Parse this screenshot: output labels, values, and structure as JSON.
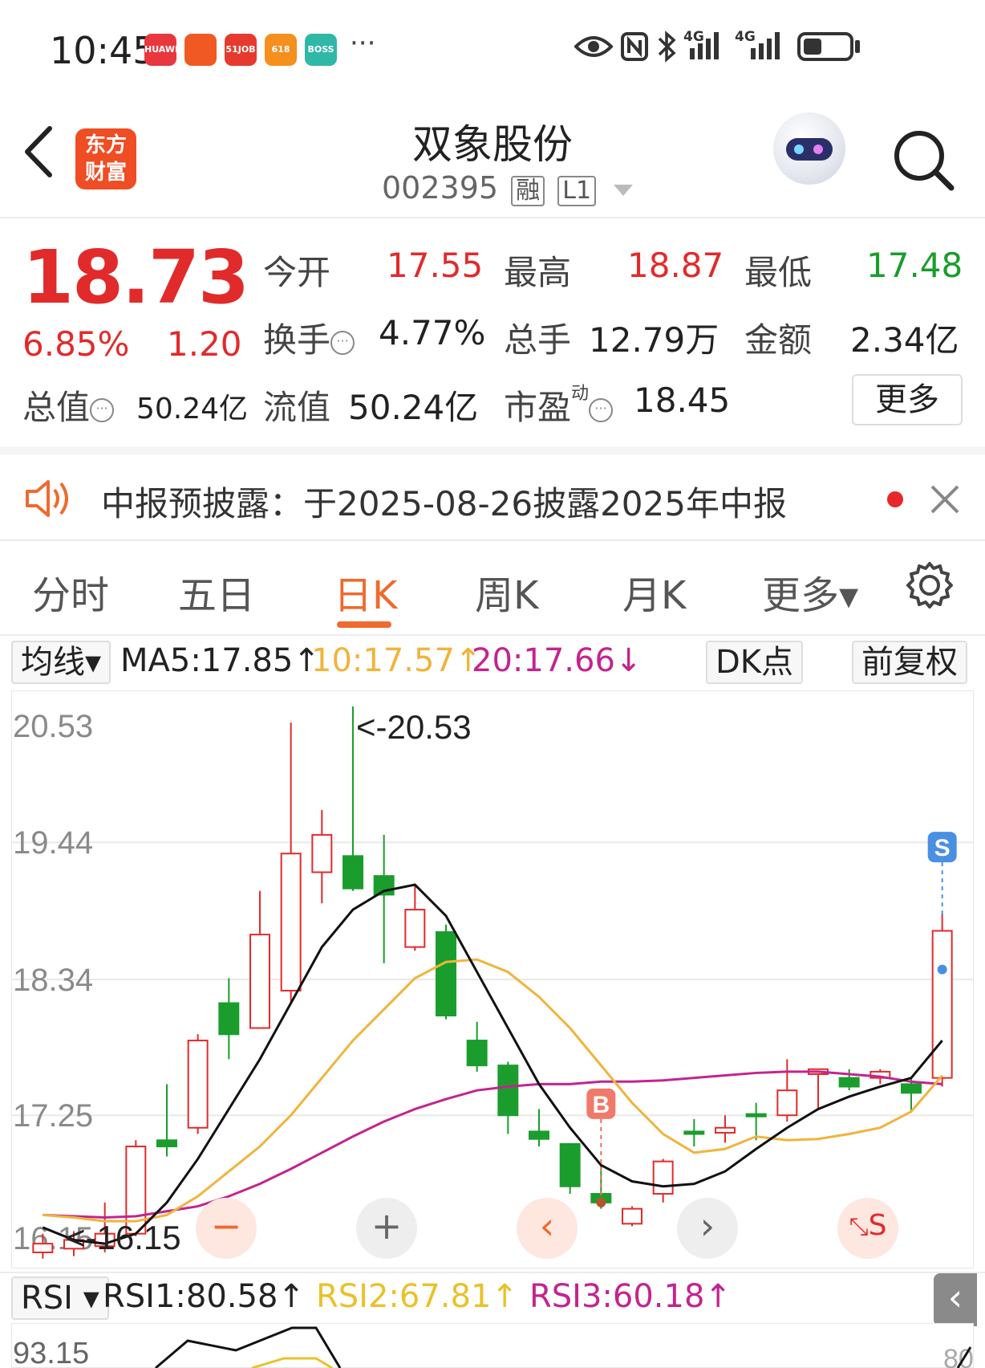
{
  "status_bar": {
    "time": "10:45",
    "apps": [
      {
        "name": "huawei-appgallery-icon",
        "label": "HUAWEI",
        "color": "#e8383d"
      },
      {
        "name": "flash-app-icon",
        "label": "",
        "color": "#f05a22"
      },
      {
        "name": "job-51-app-icon",
        "label": "51JOB",
        "color": "#e63a2e"
      },
      {
        "name": "shopping-618-app-icon",
        "label": "618",
        "color": "#f58f1e"
      },
      {
        "name": "boss-zhipin-app-icon",
        "label": "BOSS 直聘",
        "color": "#2fb7a8"
      }
    ],
    "more": "···",
    "signal_1": "4G",
    "signal_2": "4G"
  },
  "header": {
    "logo_text": "东方\n财富",
    "title": "双象股份",
    "code": "002395",
    "tag_1": "融",
    "tag_2": "L1"
  },
  "quote": {
    "price": "18.73",
    "change_pct": "6.85%",
    "change_amt": "1.20",
    "open_label": "今开",
    "open_value": "17.55",
    "high_label": "最高",
    "high_value": "18.87",
    "low_label": "最低",
    "low_value": "17.48",
    "turnover_label": "换手",
    "turnover_value": "4.77%",
    "volume_label": "总手",
    "volume_value": "12.79万",
    "amount_label": "金额",
    "amount_value": "2.34亿",
    "mktcap_label": "总值",
    "mktcap_value": "50.24亿",
    "float_label": "流值",
    "float_value": "50.24亿",
    "pe_label": "市盈",
    "pe_super": "动",
    "pe_value": "18.45",
    "more_button": "更多"
  },
  "notice": {
    "text": "中报预披露：于2025-08-26披露2025年中报"
  },
  "tabs": [
    "分时",
    "五日",
    "日K",
    "周K",
    "月K",
    "更多▾"
  ],
  "active_tab": 2,
  "indicator": {
    "select_label": "均线▾",
    "ma5": "MA5:17.85↑",
    "ma10": "10:17.57↑",
    "ma20": "20:17.66↓",
    "dk_button": "DK点",
    "adjust_button": "前复权"
  },
  "chart_data": {
    "type": "candlestick",
    "y_ticks": [
      "20.53",
      "19.44",
      "18.34",
      "17.25",
      "16.15"
    ],
    "ylim": [
      16.15,
      20.53
    ],
    "max_label": "<-20.53",
    "min_label": "<-16.15",
    "candles": [
      {
        "o": 16.15,
        "c": 16.22,
        "h": 16.3,
        "l": 16.1
      },
      {
        "o": 16.18,
        "c": 16.25,
        "h": 16.32,
        "l": 16.12
      },
      {
        "o": 16.2,
        "c": 16.3,
        "h": 16.55,
        "l": 16.15
      },
      {
        "o": 16.3,
        "c": 17.0,
        "h": 17.05,
        "l": 16.28
      },
      {
        "o": 17.05,
        "c": 17.0,
        "h": 17.5,
        "l": 16.92
      },
      {
        "o": 17.15,
        "c": 17.85,
        "h": 17.9,
        "l": 17.1
      },
      {
        "o": 18.15,
        "c": 17.9,
        "h": 18.35,
        "l": 17.7
      },
      {
        "o": 17.95,
        "c": 18.7,
        "h": 19.05,
        "l": 17.95
      },
      {
        "o": 18.25,
        "c": 19.35,
        "h": 20.4,
        "l": 18.15
      },
      {
        "o": 19.2,
        "c": 19.5,
        "h": 19.7,
        "l": 18.95
      },
      {
        "o": 19.33,
        "c": 19.07,
        "h": 20.53,
        "l": 19.05
      },
      {
        "o": 19.17,
        "c": 19.02,
        "h": 19.5,
        "l": 18.47
      },
      {
        "o": 18.6,
        "c": 18.9,
        "h": 19.1,
        "l": 18.57
      },
      {
        "o": 18.72,
        "c": 18.05,
        "h": 18.78,
        "l": 18.02
      },
      {
        "o": 17.85,
        "c": 17.65,
        "h": 18.0,
        "l": 17.6
      },
      {
        "o": 17.65,
        "c": 17.25,
        "h": 17.68,
        "l": 17.1
      },
      {
        "o": 17.12,
        "c": 17.06,
        "h": 17.3,
        "l": 17.0
      },
      {
        "o": 17.02,
        "c": 16.68,
        "h": 17.02,
        "l": 16.62
      },
      {
        "o": 16.62,
        "c": 16.55,
        "h": 16.85,
        "l": 16.5
      },
      {
        "o": 16.38,
        "c": 16.5,
        "h": 16.52,
        "l": 16.36
      },
      {
        "o": 16.62,
        "c": 16.88,
        "h": 16.9,
        "l": 16.55
      },
      {
        "o": 17.12,
        "c": 17.1,
        "h": 17.22,
        "l": 17.0
      },
      {
        "o": 17.11,
        "c": 17.15,
        "h": 17.25,
        "l": 17.03
      },
      {
        "o": 17.26,
        "c": 17.25,
        "h": 17.35,
        "l": 17.05
      },
      {
        "o": 17.25,
        "c": 17.45,
        "h": 17.7,
        "l": 17.2
      },
      {
        "o": 17.58,
        "c": 17.62,
        "h": 17.62,
        "l": 17.3
      },
      {
        "o": 17.55,
        "c": 17.48,
        "h": 17.62,
        "l": 17.45
      },
      {
        "o": 17.55,
        "c": 17.6,
        "h": 17.62,
        "l": 17.5
      },
      {
        "o": 17.5,
        "c": 17.43,
        "h": 17.55,
        "l": 17.27
      },
      {
        "o": 17.55,
        "c": 18.73,
        "h": 18.87,
        "l": 17.48
      }
    ],
    "ma5": [
      16.35,
      16.25,
      16.22,
      16.3,
      16.55,
      16.9,
      17.3,
      17.7,
      18.15,
      18.6,
      18.9,
      19.05,
      19.1,
      18.85,
      18.4,
      17.95,
      17.5,
      17.15,
      16.85,
      16.72,
      16.68,
      16.7,
      16.8,
      16.98,
      17.15,
      17.3,
      17.4,
      17.48,
      17.55,
      17.85
    ],
    "ma10": [
      16.45,
      16.43,
      16.4,
      16.4,
      16.45,
      16.6,
      16.8,
      17.0,
      17.25,
      17.55,
      17.85,
      18.1,
      18.35,
      18.48,
      18.5,
      18.4,
      18.2,
      17.95,
      17.65,
      17.35,
      17.1,
      16.95,
      16.98,
      17.08,
      17.05,
      17.06,
      17.1,
      17.15,
      17.28,
      17.57
    ],
    "ma20": [
      16.45,
      16.44,
      16.43,
      16.44,
      16.48,
      16.52,
      16.6,
      16.7,
      16.82,
      16.95,
      17.08,
      17.2,
      17.3,
      17.38,
      17.45,
      17.48,
      17.5,
      17.5,
      17.52,
      17.52,
      17.53,
      17.55,
      17.57,
      17.59,
      17.6,
      17.6,
      17.58,
      17.56,
      17.52,
      17.5
    ],
    "buy_marker": {
      "index": 18,
      "label": "B"
    },
    "sell_marker": {
      "index": 29,
      "label": "S"
    }
  },
  "controls": {
    "zoom_out": "−",
    "zoom_in": "+",
    "prev": "‹",
    "next": "›",
    "fullscreen_s": "S"
  },
  "rsi": {
    "select_label": "RSI ▾",
    "rsi1": "RSI1:80.58↑",
    "rsi2": "RSI2:67.81↑",
    "rsi3": "RSI3:60.18↑",
    "top_tick": "93.15",
    "right_tick": "80",
    "side_tab": "‹"
  },
  "colors": {
    "up": "#e12b2b",
    "down": "#1a9d2d",
    "accent": "#ef6a2e",
    "ma5": "#111111",
    "ma10": "#f0b43c",
    "ma20": "#c3248f"
  }
}
